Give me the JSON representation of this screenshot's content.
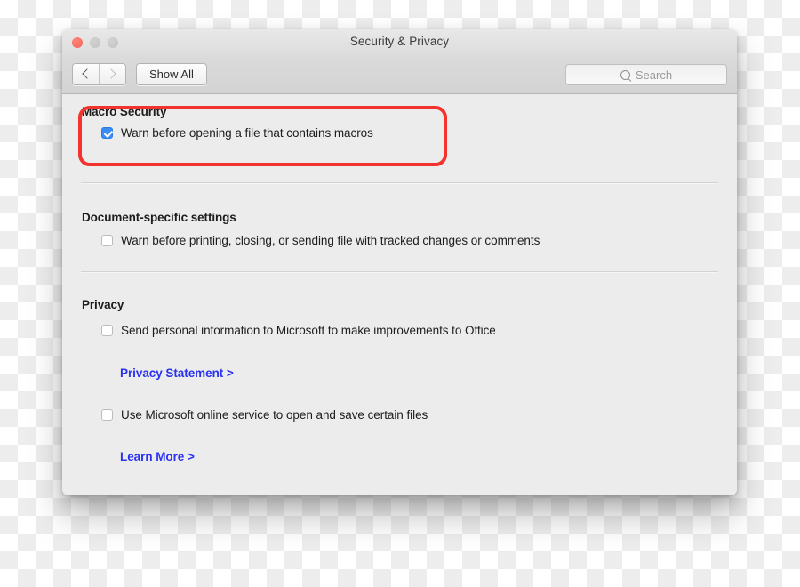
{
  "window": {
    "title": "Security & Privacy",
    "traffic_lights": [
      {
        "name": "close-button",
        "color": "#f3665a"
      },
      {
        "name": "minimize-button",
        "color": "#c8c8c8"
      },
      {
        "name": "zoom-button",
        "color": "#c8c8c8"
      }
    ]
  },
  "toolbar": {
    "back_icon": "chevron-left-icon",
    "forward_icon": "chevron-right-icon",
    "show_all_label": "Show All",
    "search": {
      "icon": "search-icon",
      "placeholder": "Search",
      "value": ""
    }
  },
  "sections": {
    "macro_security": {
      "title": "Macro Security",
      "checkbox": {
        "label": "Warn before opening a file that contains macros",
        "checked": true
      },
      "highlighted": true,
      "highlight_color": "#f4332f"
    },
    "document_specific": {
      "title": "Document-specific settings",
      "checkbox": {
        "label": "Warn before printing, closing, or sending file with tracked changes or comments",
        "checked": false
      }
    },
    "privacy": {
      "title": "Privacy",
      "checkbox_send_info": {
        "label": "Send personal information to Microsoft to make improvements to Office",
        "checked": false
      },
      "privacy_statement_link": "Privacy Statement >",
      "checkbox_online_service": {
        "label": "Use Microsoft online service to open and save certain files",
        "checked": false
      },
      "learn_more_link": "Learn More >",
      "link_color": "#2a31f0"
    }
  }
}
